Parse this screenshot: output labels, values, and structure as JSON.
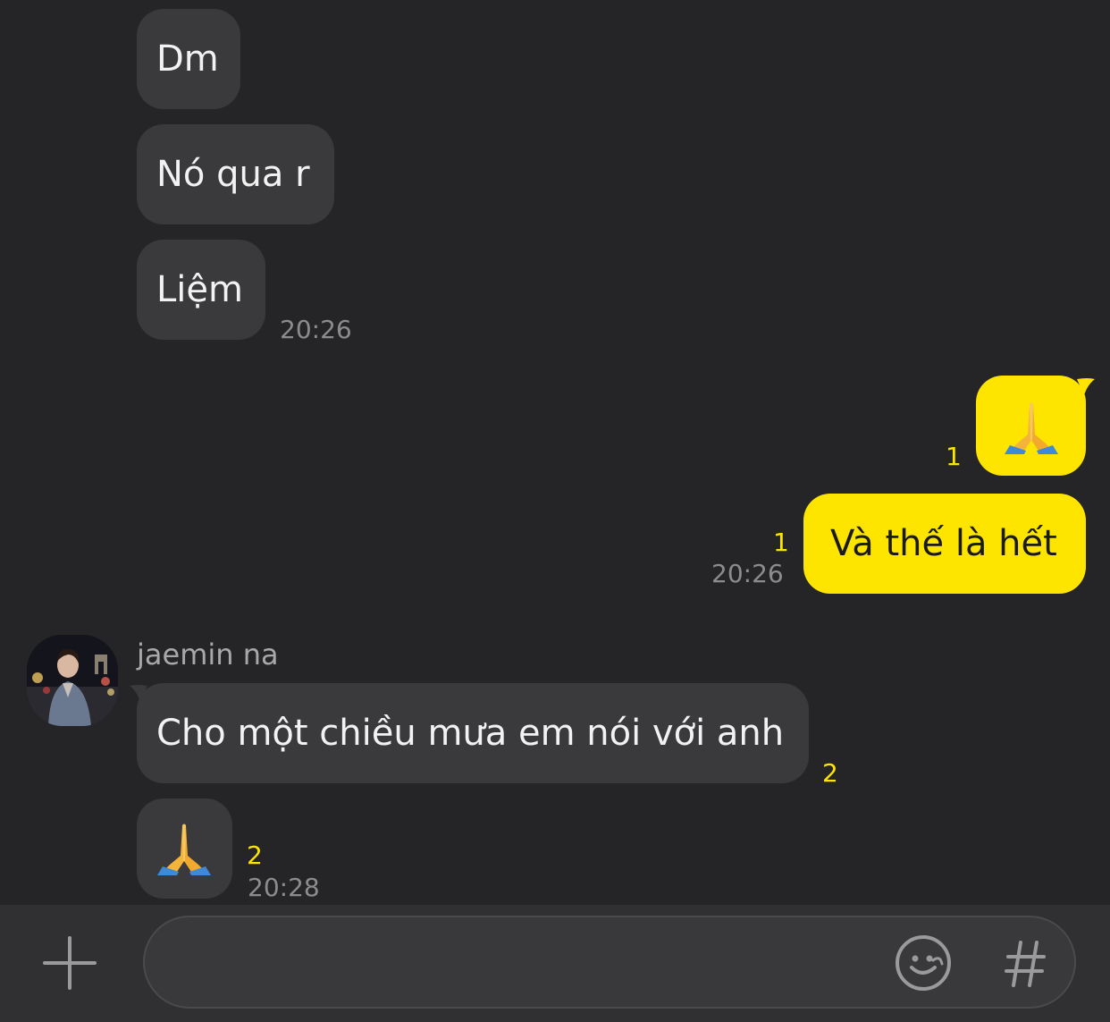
{
  "messages": {
    "m1": {
      "text": "Dm"
    },
    "m2": {
      "text": "Nó qua r"
    },
    "m3": {
      "text": "Liệm",
      "time": "20:26"
    },
    "m4": {
      "unread": "1"
    },
    "m5": {
      "text": "Và thế là hết",
      "unread": "1",
      "time": "20:26"
    },
    "m6": {
      "sender": "jaemin na",
      "text": "Cho một chiều mưa em nói với anh",
      "unread": "2"
    },
    "m7": {
      "unread": "2",
      "time": "20:28"
    }
  },
  "input": {
    "placeholder": "",
    "value": ""
  },
  "icons": {
    "attach": "plus-icon",
    "emoticon": "smiley-icon",
    "hashtag": "hashtag-icon",
    "praying_hands": "praying-hands-emoji"
  },
  "colors": {
    "background": "#252527",
    "incoming_bubble": "#3a3a3d",
    "outgoing_bubble": "#fee500",
    "unread_count": "#fee500",
    "timestamp": "#8c8c8e"
  }
}
